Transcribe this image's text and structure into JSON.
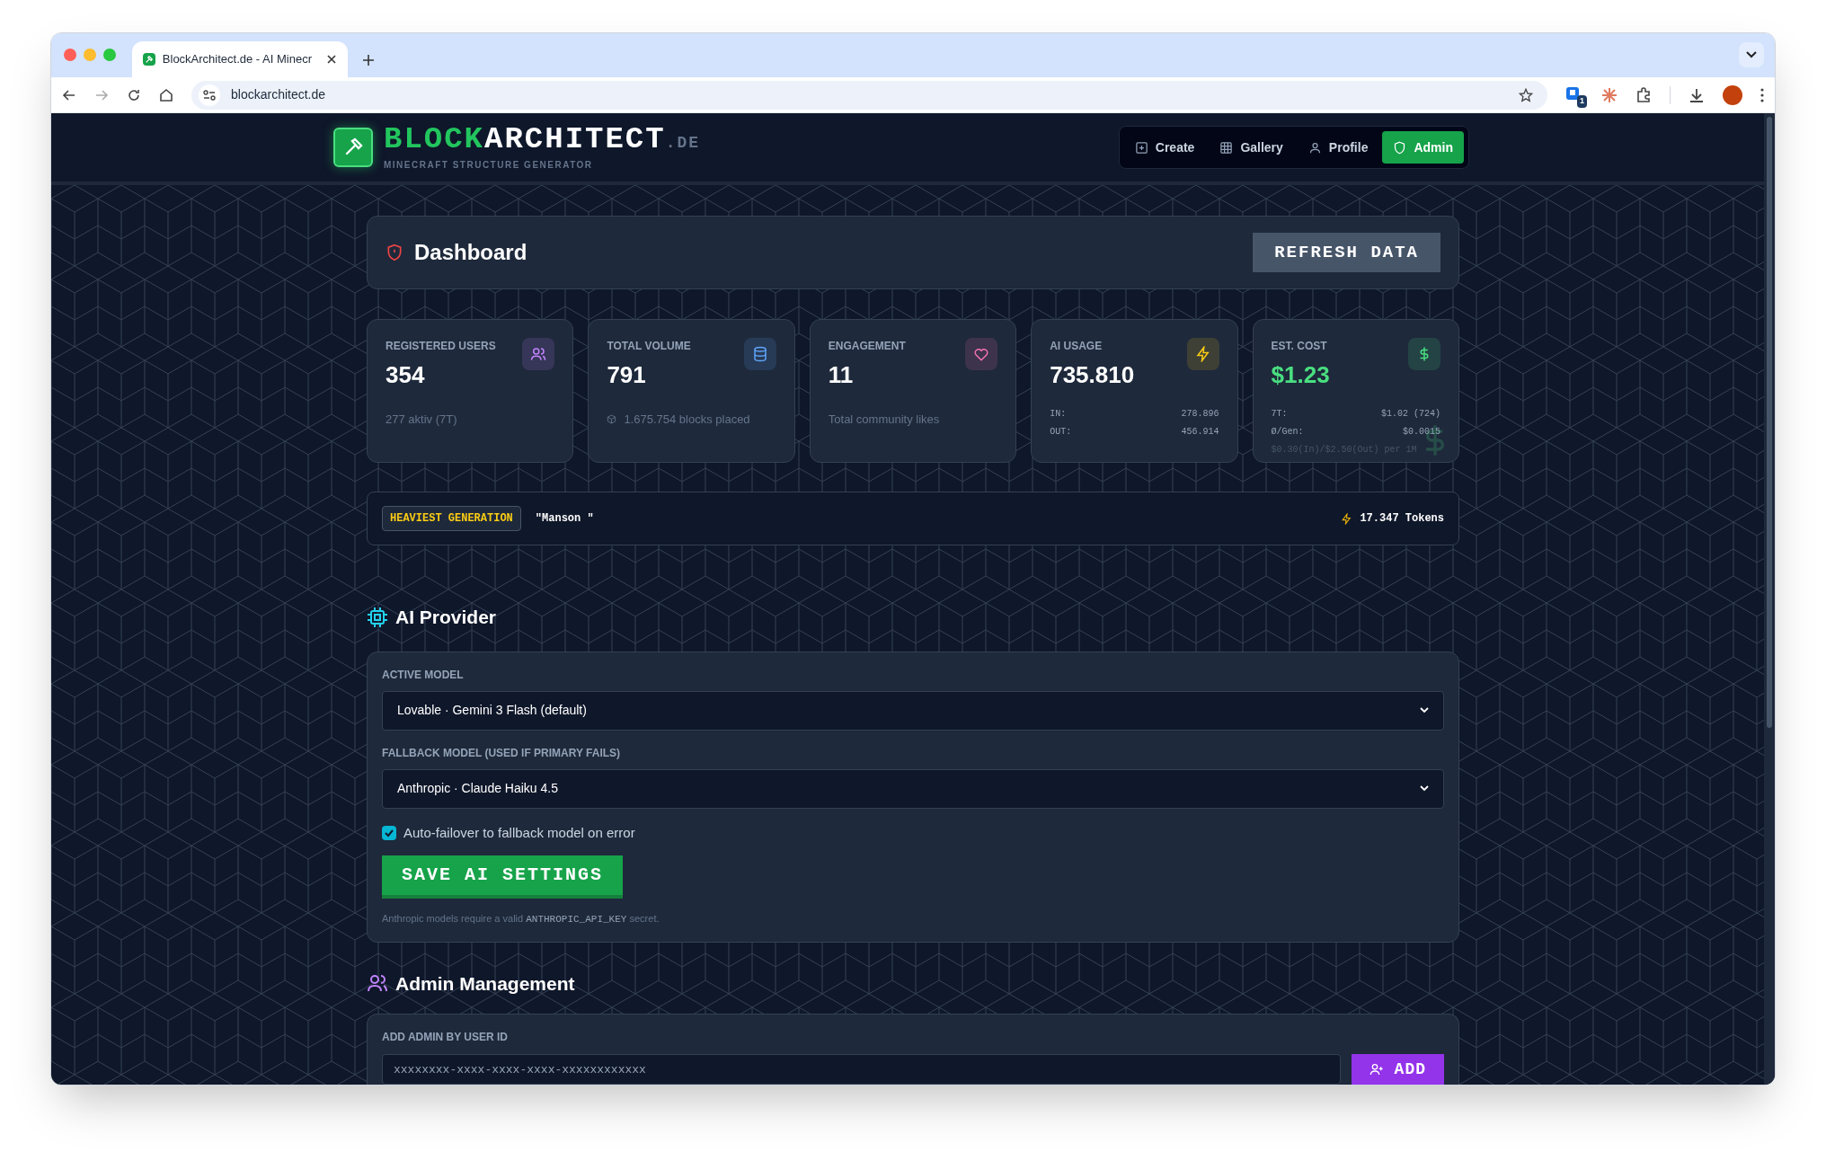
{
  "browser": {
    "tab_title": "BlockArchitect.de - AI Minecr",
    "url": "blockarchitect.de",
    "extension_badge": "1"
  },
  "header": {
    "logo": {
      "part1": "BLOCK",
      "part2": "ARCHITECT",
      "suffix": ".DE",
      "tagline": "MINECRAFT STRUCTURE GENERATOR"
    },
    "nav": [
      {
        "label": "Create",
        "selected": false
      },
      {
        "label": "Gallery",
        "selected": false
      },
      {
        "label": "Profile",
        "selected": false
      },
      {
        "label": "Admin",
        "selected": true
      }
    ]
  },
  "dashboard": {
    "title": "Dashboard",
    "refresh_button": "REFRESH DATA"
  },
  "stats": [
    {
      "kind": "note",
      "label": "REGISTERED USERS",
      "value": "354",
      "color": "#c084fc",
      "note": "277 aktiv (7T)"
    },
    {
      "kind": "note",
      "label": "TOTAL VOLUME",
      "value": "791",
      "color": "#60a5fa",
      "note": "1.675.754 blocks placed",
      "note_icon": true
    },
    {
      "kind": "note",
      "label": "ENGAGEMENT",
      "value": "11",
      "color": "#f472b6",
      "note": "Total community likes"
    },
    {
      "kind": "breakdown",
      "label": "AI USAGE",
      "value": "735.810",
      "color": "#facc15",
      "rows": [
        {
          "label": "IN:",
          "value": "278.896"
        },
        {
          "label": "OUT:",
          "value": "456.914"
        }
      ]
    },
    {
      "kind": "breakdown",
      "label": "EST. COST",
      "value": "$1.23",
      "color": "#4ade80",
      "highlight": true,
      "rows": [
        {
          "label": "7T:",
          "value": "$1.02 (724)"
        },
        {
          "label": "Ø/Gen:",
          "value": "$0.0015"
        }
      ],
      "footnote": "$0.30(In)/$2.50(Out) per 1M"
    }
  ],
  "heaviest": {
    "badge": "HEAVIEST GENERATION",
    "name": "\"Manson \"",
    "tokens": "17.347 Tokens"
  },
  "ai_provider": {
    "title": "AI Provider",
    "selects": [
      {
        "label": "ACTIVE MODEL",
        "value": "Lovable · Gemini 3 Flash (default)"
      },
      {
        "label": "FALLBACK MODEL (USED IF PRIMARY FAILS)",
        "value": "Anthropic · Claude Haiku 4.5"
      }
    ],
    "checkbox": {
      "label": "Auto-failover to fallback model on error",
      "checked": true
    },
    "save_button": "SAVE AI SETTINGS",
    "note_before": "Anthropic models require a valid",
    "note_code": "ANTHROPIC_API_KEY",
    "note_after": "secret."
  },
  "admin": {
    "title": "Admin Management",
    "field_label": "ADD ADMIN BY USER ID",
    "placeholder": "xxxxxxxx-xxxx-xxxx-xxxx-xxxxxxxxxxxx",
    "add_button": "ADD"
  }
}
